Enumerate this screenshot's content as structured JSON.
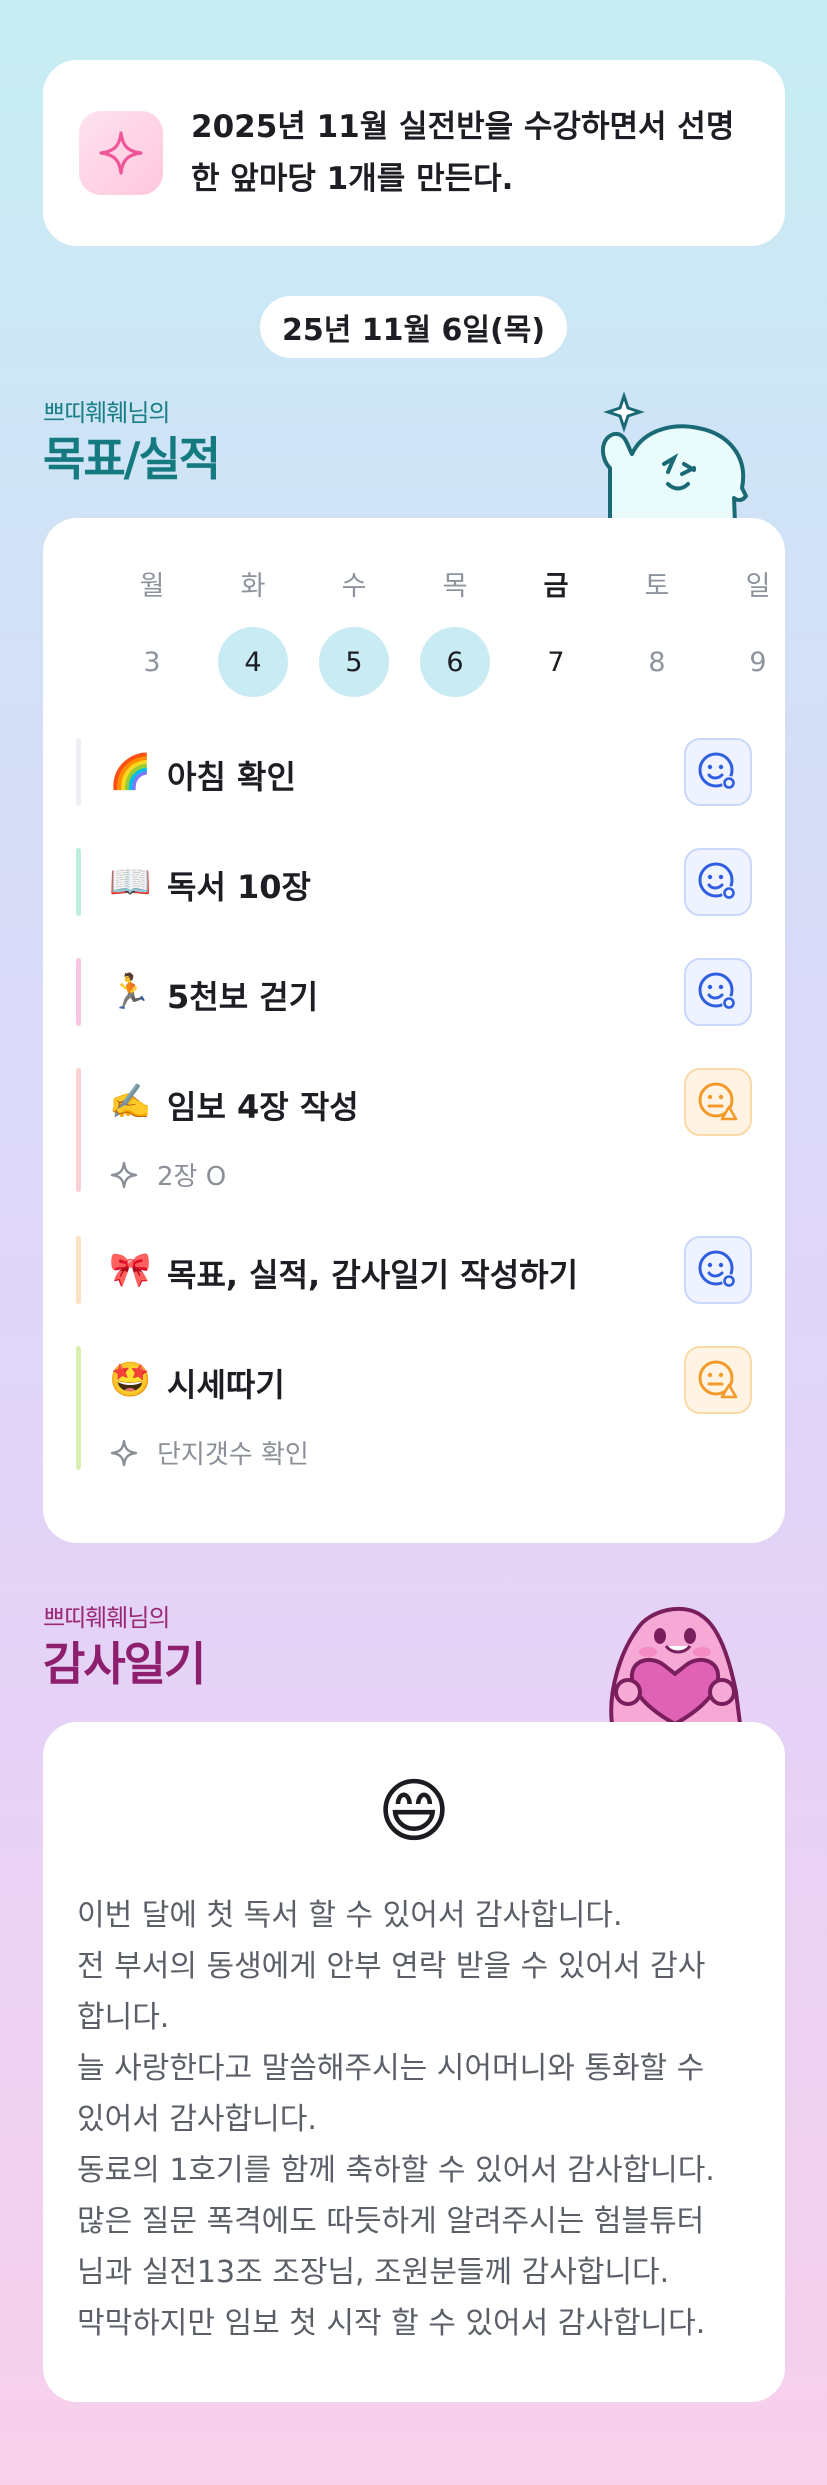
{
  "goal": {
    "text": "2025년 11월 실전반을 수강하면서 선명한 앞마당 1개를 만든다.",
    "icon": "sparkle-icon"
  },
  "date": "25년 11월 6일(목)",
  "goals_section": {
    "owner": "쁘띠훼훼님의",
    "title": "목표/실적"
  },
  "week": {
    "days": [
      {
        "weekday": "월",
        "date": "3",
        "state": "none"
      },
      {
        "weekday": "화",
        "date": "4",
        "state": "done"
      },
      {
        "weekday": "수",
        "date": "5",
        "state": "done"
      },
      {
        "weekday": "목",
        "date": "6",
        "state": "done"
      },
      {
        "weekday": "금",
        "date": "7",
        "state": "today"
      },
      {
        "weekday": "토",
        "date": "8",
        "state": "none"
      },
      {
        "weekday": "일",
        "date": "9",
        "state": "none"
      }
    ]
  },
  "items": [
    {
      "emoji": "🌈",
      "label": "아침 확인",
      "status": "good",
      "note": "",
      "color": "#ededf3"
    },
    {
      "emoji": "📖",
      "label": "독서 10장",
      "status": "good",
      "note": "",
      "color": "#bfeedd"
    },
    {
      "emoji": "🏃",
      "label": "5천보 걷기",
      "status": "good",
      "note": "",
      "color": "#f8c6e3"
    },
    {
      "emoji": "✍️",
      "label": "임보 4장 작성",
      "status": "warn",
      "note": "2장 O",
      "color": "#fbd2d4"
    },
    {
      "emoji": "🎀",
      "label": "목표, 실적, 감사일기 작성하기",
      "status": "good",
      "note": "",
      "color": "#fde2c2"
    },
    {
      "emoji": "🤩",
      "label": "시세따기",
      "status": "warn",
      "note": "단지갯수 확인",
      "color": "#d8f0b4"
    }
  ],
  "thanks_section": {
    "owner": "쁘띠훼훼님의",
    "title": "감사일기"
  },
  "thanks": {
    "emoji": "😄",
    "lines": [
      "이번 달에 첫 독서 할 수 있어서 감사합니다.",
      "전 부서의 동생에게 안부 연락 받을 수 있어서 감사",
      "합니다.",
      "늘 사랑한다고 말씀해주시는 시어머니와 통화할 수",
      "있어서 감사합니다.",
      "동료의 1호기를 함께 축하할 수 있어서 감사합니다.",
      "많은 질문 폭격에도 따듯하게 알려주시는 험블튜터",
      "님과 실전13조 조장님, 조원분들께 감사합니다.",
      "막막하지만 임보 첫 시작 할 수 있어서 감사합니다."
    ]
  },
  "colors": {
    "accent_teal": "#147a80",
    "accent_magenta": "#8d1f6e",
    "status_good": "#2f5fe0",
    "status_warn": "#f39a2a"
  }
}
